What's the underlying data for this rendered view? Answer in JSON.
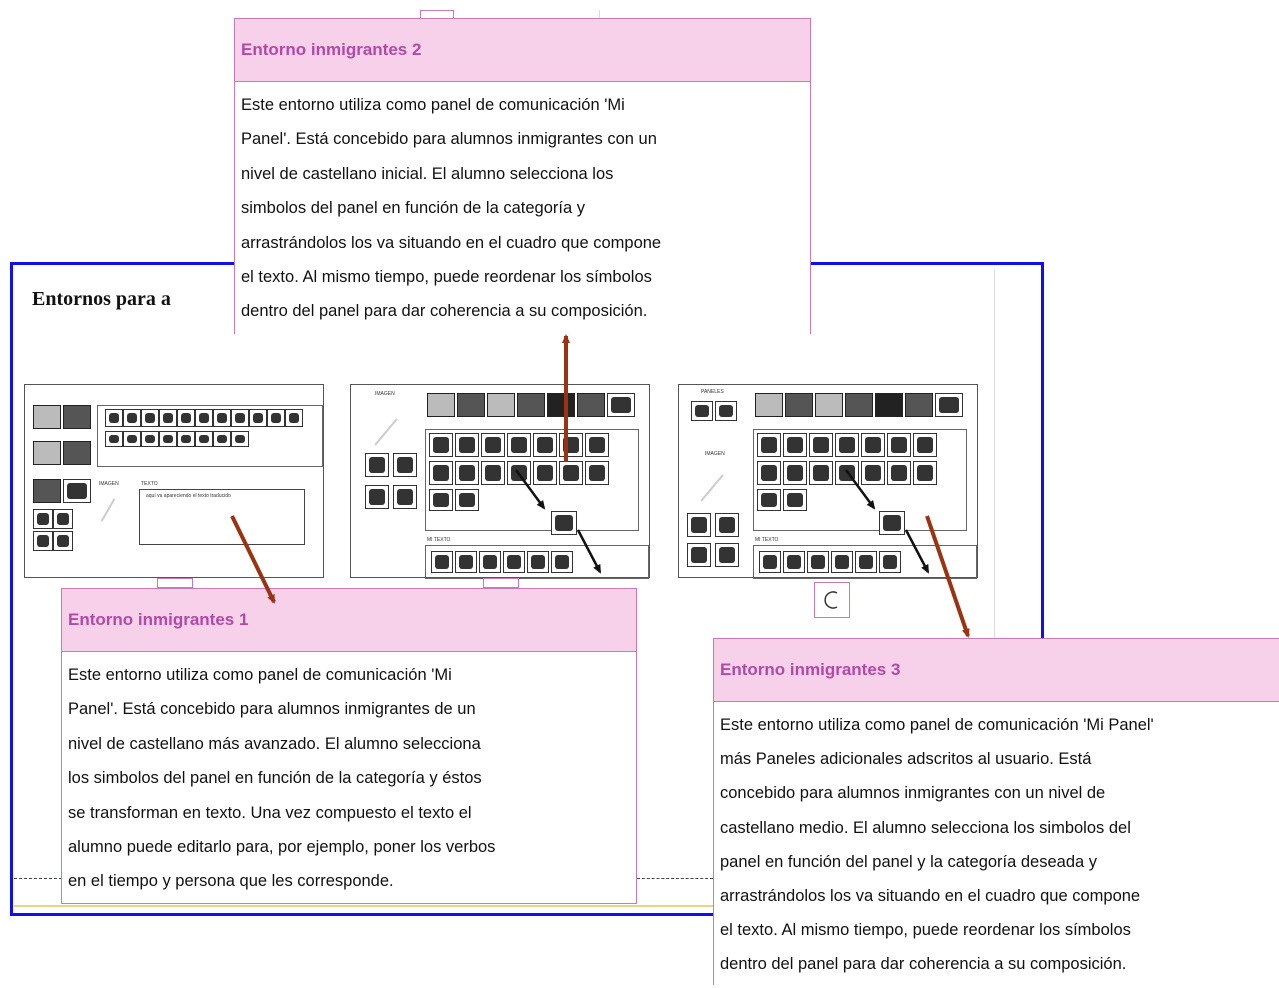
{
  "page_title": "Entornos para a",
  "popups": [
    {
      "title": "Entorno inmigrantes 2",
      "lines": [
        "Este entorno utiliza como panel de comunicación 'Mi",
        "Panel'. Está concebido para alumnos inmigrantes con un",
        "nivel de castellano inicial. El alumno selecciona los",
        "simbolos del panel en función de la categoría y",
        "arrastrándolos los va situando en el cuadro que compone",
        "el texto. Al mismo tiempo, puede reordenar los símbolos",
        "dentro del panel para dar coherencia a su composición."
      ]
    },
    {
      "title": "Entorno inmigrantes 1",
      "lines": [
        "Este entorno utiliza como panel de comunicación 'Mi",
        "Panel'. Está concebido para alumnos inmigrantes de un",
        "nivel de castellano más avanzado. El alumno selecciona",
        "los simbolos del panel en función de la categoría y éstos",
        "se transforman en texto. Una vez compuesto el texto el",
        "alumno puede editarlo para, por ejemplo, poner los verbos",
        "en el tiempo y persona que les corresponde."
      ]
    },
    {
      "title": "Entorno inmigrantes 3",
      "lines": [
        "Este entorno utiliza como panel de comunicación 'Mi Panel'",
        "más Paneles adicionales adscritos al usuario. Está",
        "concebido para alumnos inmigrantes con un nivel de",
        "castellano medio. El alumno selecciona los simbolos del",
        "panel en función del panel y la categoría deseada y",
        "arrastrándolos los va situando en el cuadro que compone",
        "el texto. Al mismo tiempo, puede reordenar los símbolos",
        "dentro del panel para dar coherencia a su composición."
      ]
    }
  ],
  "thumbnails": [
    {
      "small_text": "aquí va apareciendo el texto traducido",
      "label_a": "IMAGEN",
      "label_b": "TEXTO"
    },
    {
      "label_top": "IMAGEN",
      "label_bottom": "MI TEXTO"
    },
    {
      "label_top": "PANELES",
      "label_mid": "IMAGEN",
      "label_bottom": "MI TEXTO"
    }
  ],
  "colors": {
    "frame": "#1010ee",
    "popup_header": "#f7d0ea",
    "popup_title": "#b14aa6",
    "arrow": "#993311"
  },
  "icons": [
    "loading-spinner-icon",
    "arrow-icon"
  ]
}
